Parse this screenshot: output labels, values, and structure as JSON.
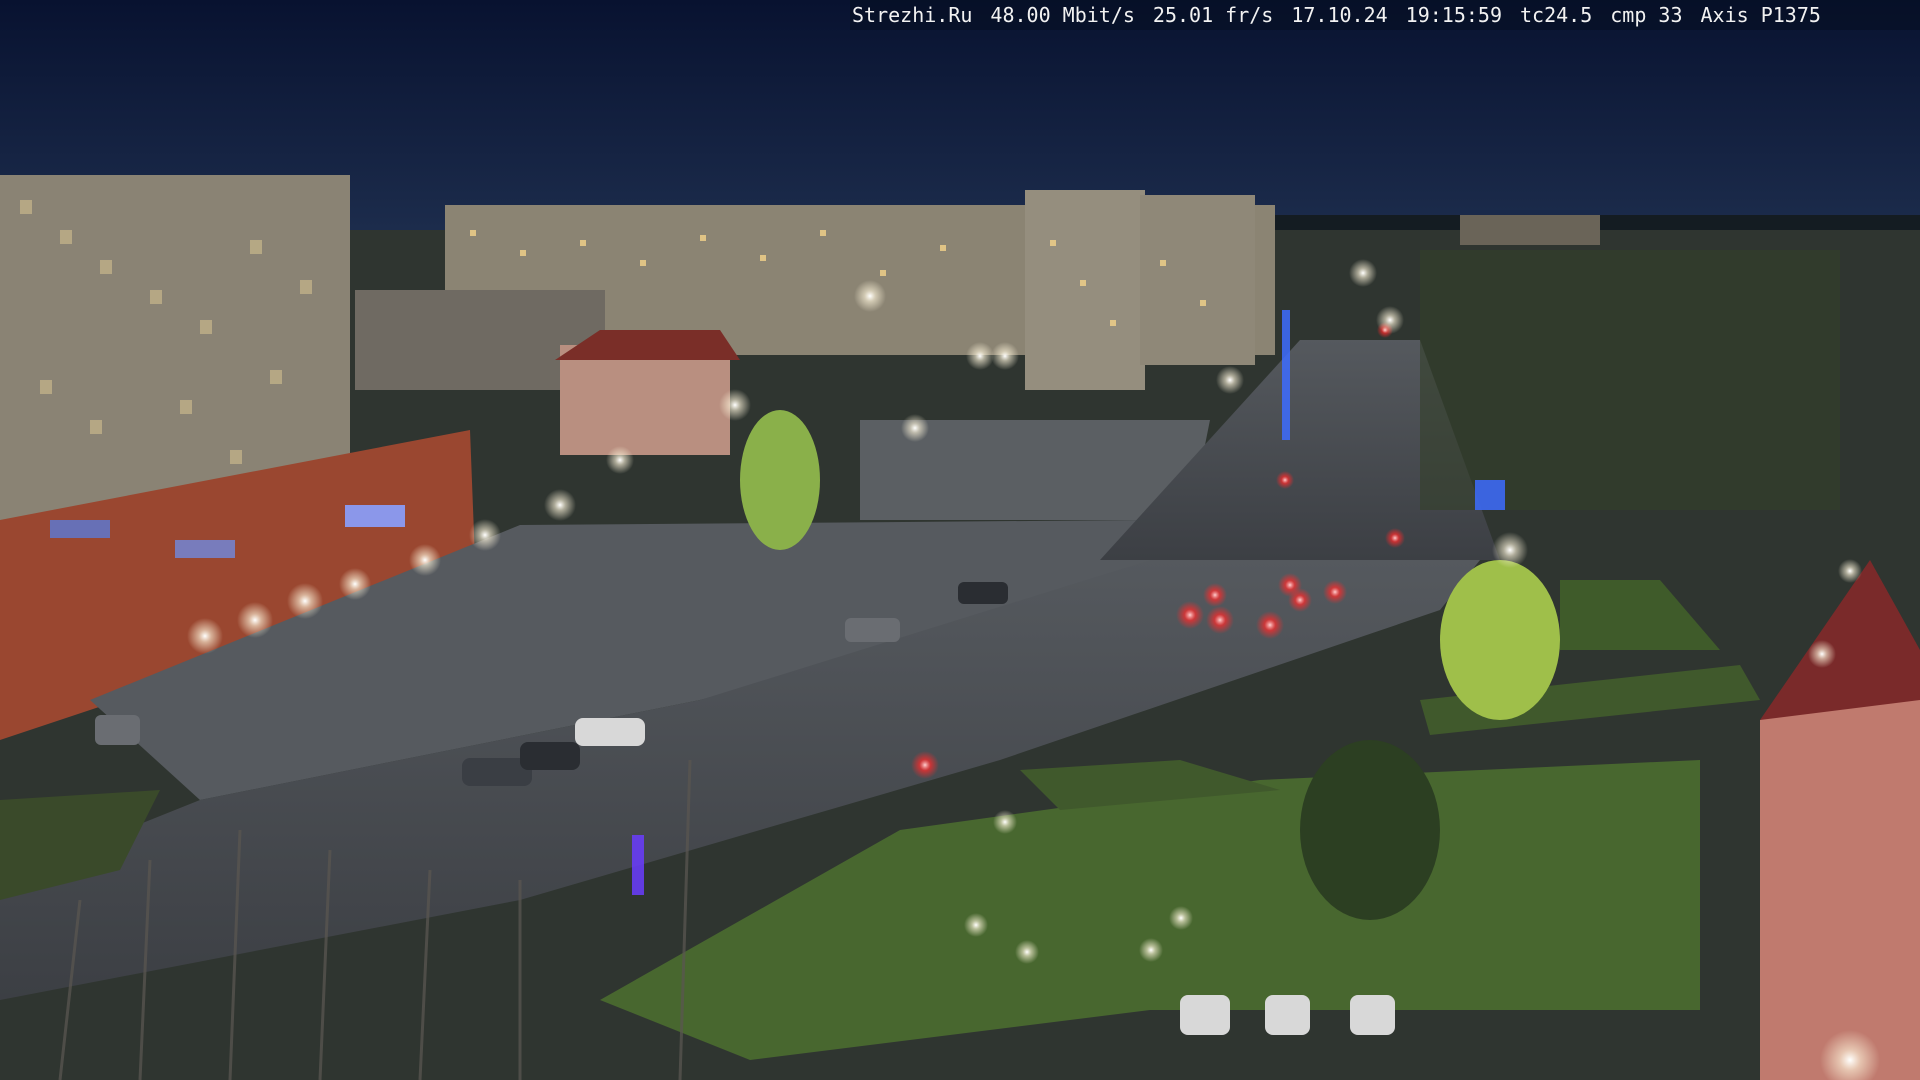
{
  "overlay": {
    "site": "Strezhi.Ru",
    "bitrate": "48.00 Mbit/s",
    "framerate": "25.01 fr/s",
    "date": "17.10.24",
    "time": "19:15:59",
    "tc": "tc24.5",
    "cmp": "cmp 33",
    "camera": "Axis P1375"
  },
  "colors": {
    "sky_top": "#0a1530",
    "sky_bottom": "#1a2a4a",
    "road": "#4b4f55",
    "grass": "#3f5a2c",
    "building_left": "#8c8576",
    "store_front": "#a64a34",
    "lamp_glow": "#f4f2e0",
    "traffic_red": "#ff3030"
  }
}
